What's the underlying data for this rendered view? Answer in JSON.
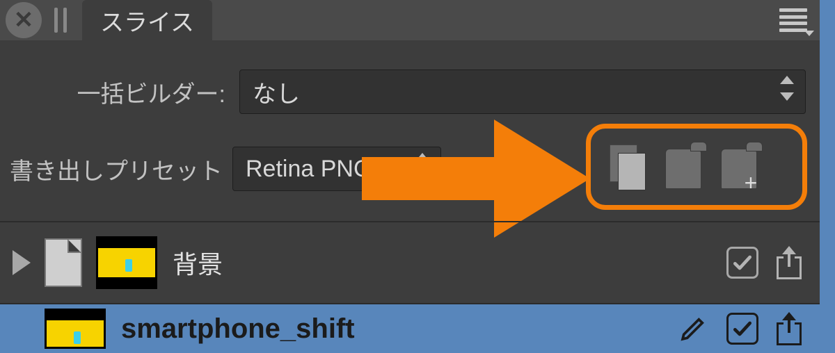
{
  "header": {
    "tab_label": "スライス"
  },
  "builder": {
    "label": "一括ビルダー:",
    "value": "なし"
  },
  "preset": {
    "label": "書き出しプリセット",
    "value": "Retina PNG-24"
  },
  "icons": {
    "copy": "copy-icon",
    "clipboard": "clipboard-icon",
    "clipboard_add": "clipboard-add-icon"
  },
  "list": {
    "rows": [
      {
        "name": "背景",
        "checked": true
      },
      {
        "name": "smartphone_shift",
        "checked": true
      }
    ]
  }
}
